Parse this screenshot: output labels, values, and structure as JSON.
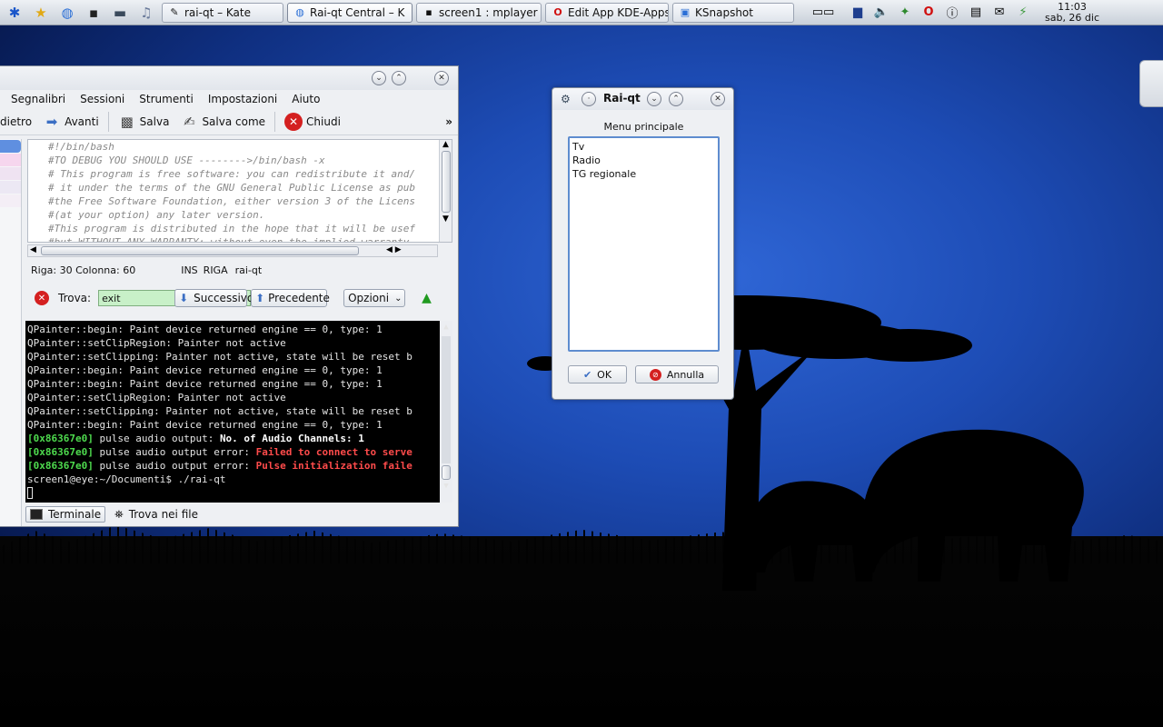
{
  "panel": {
    "tasks": [
      {
        "label": "rai-qt – Kate",
        "icon": "kate-icon"
      },
      {
        "label": "Rai-qt  Central – K",
        "icon": "konqueror-icon"
      },
      {
        "label": "screen1 : mplayer",
        "icon": "terminal-icon"
      },
      {
        "label": "Edit App KDE-Apps",
        "icon": "opera-icon"
      },
      {
        "label": "KSnapshot",
        "icon": "ksnapshot-icon"
      }
    ],
    "clock": {
      "time": "11:03",
      "date": "sab, 26 dic"
    }
  },
  "kate": {
    "menu": [
      "Segnalibri",
      "Sessioni",
      "Strumenti",
      "Impostazioni",
      "Aiuto"
    ],
    "toolbar": {
      "back": "dietro",
      "forward": "Avanti",
      "save": "Salva",
      "save_as": "Salva come",
      "close": "Chiudi",
      "more": "»"
    },
    "code_lines": [
      "#!/bin/bash",
      "#TO DEBUG YOU SHOULD USE -------->/bin/bash -x",
      "# This program is free software: you can redistribute it and/",
      "# it under the terms of the GNU General Public License as pub",
      "#the Free Software Foundation, either version 3 of the Licens",
      "#(at your option) any later version.",
      "#This program is distributed in the hope that it will be usef",
      "#but WITHOUT ANY WARRANTY; without even the implied warranty"
    ],
    "status": {
      "position": "Riga: 30 Colonna: 60",
      "mode": "INS",
      "line_mode": "RIGA",
      "doc": "rai-qt"
    },
    "find": {
      "label": "Trova:",
      "value": "exit",
      "next": "Successivo",
      "prev": "Precedente",
      "options": "Opzioni"
    },
    "terminal": {
      "plain_lines": [
        "QPainter::begin: Paint device returned engine == 0, type: 1",
        "QPainter::setClipRegion: Painter not active",
        "QPainter::setClipping: Painter not active, state will be reset b",
        "QPainter::begin: Paint device returned engine == 0, type: 1",
        "QPainter::begin: Paint device returned engine == 0, type: 1",
        "QPainter::setClipRegion: Painter not active",
        "QPainter::setClipping: Painter not active, state will be reset b",
        "QPainter::begin: Paint device returned engine == 0, type: 1"
      ],
      "pulse_lines": [
        {
          "hex": "[0x86367e0]",
          "prefix": " pulse audio output: ",
          "msg": "No. of Audio Channels: 1",
          "style": "bold"
        },
        {
          "hex": "[0x86367e0]",
          "prefix": " pulse audio output error: ",
          "msg": "Failed to connect to serve",
          "style": "red"
        },
        {
          "hex": "[0x86367e0]",
          "prefix": " pulse audio output error: ",
          "msg": "Pulse initialization faile",
          "style": "red"
        }
      ],
      "prompt": "screen1@eye:~/Documenti$ ./rai-qt"
    },
    "bottom_tabs": {
      "terminal": "Terminale",
      "find_in_files": "Trova nei file"
    }
  },
  "raiqt": {
    "title": "Rai-qt",
    "label": "Menu principale",
    "items": [
      "Tv",
      "Radio",
      "TG regionale"
    ],
    "ok": "OK",
    "cancel": "Annulla"
  },
  "colors": {
    "selection_blue": "#5e8ccf",
    "find_green": "#c8f0c8",
    "terminal_green": "#4edb4e",
    "terminal_red": "#ff4b4b"
  }
}
